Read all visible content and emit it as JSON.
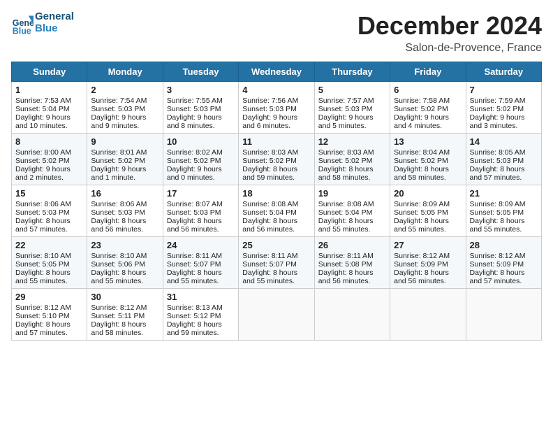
{
  "logo": {
    "general": "General",
    "blue": "Blue"
  },
  "title": "December 2024",
  "subtitle": "Salon-de-Provence, France",
  "days_of_week": [
    "Sunday",
    "Monday",
    "Tuesday",
    "Wednesday",
    "Thursday",
    "Friday",
    "Saturday"
  ],
  "weeks": [
    [
      {
        "day": "1",
        "sunrise": "Sunrise: 7:53 AM",
        "sunset": "Sunset: 5:04 PM",
        "daylight": "Daylight: 9 hours and 10 minutes."
      },
      {
        "day": "2",
        "sunrise": "Sunrise: 7:54 AM",
        "sunset": "Sunset: 5:03 PM",
        "daylight": "Daylight: 9 hours and 9 minutes."
      },
      {
        "day": "3",
        "sunrise": "Sunrise: 7:55 AM",
        "sunset": "Sunset: 5:03 PM",
        "daylight": "Daylight: 9 hours and 8 minutes."
      },
      {
        "day": "4",
        "sunrise": "Sunrise: 7:56 AM",
        "sunset": "Sunset: 5:03 PM",
        "daylight": "Daylight: 9 hours and 6 minutes."
      },
      {
        "day": "5",
        "sunrise": "Sunrise: 7:57 AM",
        "sunset": "Sunset: 5:03 PM",
        "daylight": "Daylight: 9 hours and 5 minutes."
      },
      {
        "day": "6",
        "sunrise": "Sunrise: 7:58 AM",
        "sunset": "Sunset: 5:02 PM",
        "daylight": "Daylight: 9 hours and 4 minutes."
      },
      {
        "day": "7",
        "sunrise": "Sunrise: 7:59 AM",
        "sunset": "Sunset: 5:02 PM",
        "daylight": "Daylight: 9 hours and 3 minutes."
      }
    ],
    [
      {
        "day": "8",
        "sunrise": "Sunrise: 8:00 AM",
        "sunset": "Sunset: 5:02 PM",
        "daylight": "Daylight: 9 hours and 2 minutes."
      },
      {
        "day": "9",
        "sunrise": "Sunrise: 8:01 AM",
        "sunset": "Sunset: 5:02 PM",
        "daylight": "Daylight: 9 hours and 1 minute."
      },
      {
        "day": "10",
        "sunrise": "Sunrise: 8:02 AM",
        "sunset": "Sunset: 5:02 PM",
        "daylight": "Daylight: 9 hours and 0 minutes."
      },
      {
        "day": "11",
        "sunrise": "Sunrise: 8:03 AM",
        "sunset": "Sunset: 5:02 PM",
        "daylight": "Daylight: 8 hours and 59 minutes."
      },
      {
        "day": "12",
        "sunrise": "Sunrise: 8:03 AM",
        "sunset": "Sunset: 5:02 PM",
        "daylight": "Daylight: 8 hours and 58 minutes."
      },
      {
        "day": "13",
        "sunrise": "Sunrise: 8:04 AM",
        "sunset": "Sunset: 5:02 PM",
        "daylight": "Daylight: 8 hours and 58 minutes."
      },
      {
        "day": "14",
        "sunrise": "Sunrise: 8:05 AM",
        "sunset": "Sunset: 5:03 PM",
        "daylight": "Daylight: 8 hours and 57 minutes."
      }
    ],
    [
      {
        "day": "15",
        "sunrise": "Sunrise: 8:06 AM",
        "sunset": "Sunset: 5:03 PM",
        "daylight": "Daylight: 8 hours and 57 minutes."
      },
      {
        "day": "16",
        "sunrise": "Sunrise: 8:06 AM",
        "sunset": "Sunset: 5:03 PM",
        "daylight": "Daylight: 8 hours and 56 minutes."
      },
      {
        "day": "17",
        "sunrise": "Sunrise: 8:07 AM",
        "sunset": "Sunset: 5:03 PM",
        "daylight": "Daylight: 8 hours and 56 minutes."
      },
      {
        "day": "18",
        "sunrise": "Sunrise: 8:08 AM",
        "sunset": "Sunset: 5:04 PM",
        "daylight": "Daylight: 8 hours and 56 minutes."
      },
      {
        "day": "19",
        "sunrise": "Sunrise: 8:08 AM",
        "sunset": "Sunset: 5:04 PM",
        "daylight": "Daylight: 8 hours and 55 minutes."
      },
      {
        "day": "20",
        "sunrise": "Sunrise: 8:09 AM",
        "sunset": "Sunset: 5:05 PM",
        "daylight": "Daylight: 8 hours and 55 minutes."
      },
      {
        "day": "21",
        "sunrise": "Sunrise: 8:09 AM",
        "sunset": "Sunset: 5:05 PM",
        "daylight": "Daylight: 8 hours and 55 minutes."
      }
    ],
    [
      {
        "day": "22",
        "sunrise": "Sunrise: 8:10 AM",
        "sunset": "Sunset: 5:05 PM",
        "daylight": "Daylight: 8 hours and 55 minutes."
      },
      {
        "day": "23",
        "sunrise": "Sunrise: 8:10 AM",
        "sunset": "Sunset: 5:06 PM",
        "daylight": "Daylight: 8 hours and 55 minutes."
      },
      {
        "day": "24",
        "sunrise": "Sunrise: 8:11 AM",
        "sunset": "Sunset: 5:07 PM",
        "daylight": "Daylight: 8 hours and 55 minutes."
      },
      {
        "day": "25",
        "sunrise": "Sunrise: 8:11 AM",
        "sunset": "Sunset: 5:07 PM",
        "daylight": "Daylight: 8 hours and 55 minutes."
      },
      {
        "day": "26",
        "sunrise": "Sunrise: 8:11 AM",
        "sunset": "Sunset: 5:08 PM",
        "daylight": "Daylight: 8 hours and 56 minutes."
      },
      {
        "day": "27",
        "sunrise": "Sunrise: 8:12 AM",
        "sunset": "Sunset: 5:09 PM",
        "daylight": "Daylight: 8 hours and 56 minutes."
      },
      {
        "day": "28",
        "sunrise": "Sunrise: 8:12 AM",
        "sunset": "Sunset: 5:09 PM",
        "daylight": "Daylight: 8 hours and 57 minutes."
      }
    ],
    [
      {
        "day": "29",
        "sunrise": "Sunrise: 8:12 AM",
        "sunset": "Sunset: 5:10 PM",
        "daylight": "Daylight: 8 hours and 57 minutes."
      },
      {
        "day": "30",
        "sunrise": "Sunrise: 8:12 AM",
        "sunset": "Sunset: 5:11 PM",
        "daylight": "Daylight: 8 hours and 58 minutes."
      },
      {
        "day": "31",
        "sunrise": "Sunrise: 8:13 AM",
        "sunset": "Sunset: 5:12 PM",
        "daylight": "Daylight: 8 hours and 59 minutes."
      },
      null,
      null,
      null,
      null
    ]
  ]
}
